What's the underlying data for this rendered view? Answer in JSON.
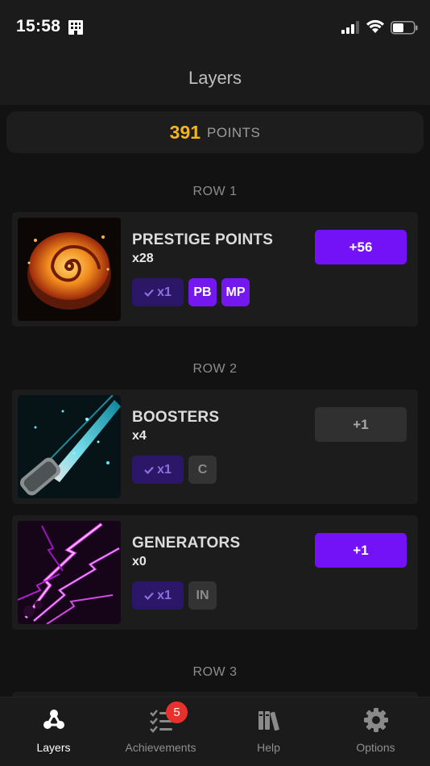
{
  "status": {
    "time": "15:58"
  },
  "header": {
    "title": "Layers"
  },
  "points": {
    "value": "391",
    "label": "POINTS"
  },
  "rows": [
    {
      "title": "ROW 1",
      "layers": [
        {
          "name": "PRESTIGE POINTS",
          "count": "x28",
          "multiplier": "x1",
          "tags": [
            {
              "label": "PB",
              "active": true
            },
            {
              "label": "MP",
              "active": true
            }
          ],
          "button": "+56",
          "button_enabled": true,
          "image_icon": "swirl-pie-icon"
        }
      ]
    },
    {
      "title": "ROW 2",
      "layers": [
        {
          "name": "BOOSTERS",
          "count": "x4",
          "multiplier": "x1",
          "tags": [
            {
              "label": "C",
              "active": false
            }
          ],
          "button": "+1",
          "button_enabled": false,
          "image_icon": "laser-beam-icon"
        },
        {
          "name": "GENERATORS",
          "count": "x0",
          "multiplier": "x1",
          "tags": [
            {
              "label": "IN",
              "active": false
            }
          ],
          "button": "+1",
          "button_enabled": true,
          "image_icon": "lightning-icon"
        }
      ]
    },
    {
      "title": "ROW 3",
      "layers": []
    }
  ],
  "tabs": [
    {
      "label": "Layers",
      "icon": "layers-icon",
      "active": true
    },
    {
      "label": "Achievements",
      "icon": "checklist-icon",
      "badge": "5"
    },
    {
      "label": "Help",
      "icon": "books-icon"
    },
    {
      "label": "Options",
      "icon": "gear-icon"
    }
  ],
  "colors": {
    "accent": "#7311f7",
    "points": "#f3b51f",
    "badge": "#e8312c",
    "background": "#121212"
  }
}
